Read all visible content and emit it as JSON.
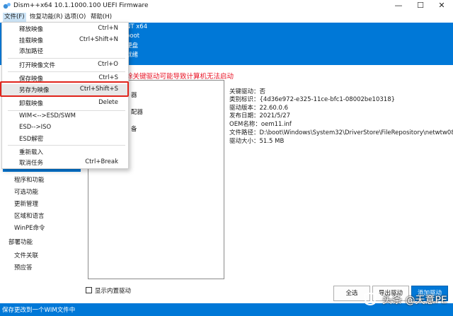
{
  "window": {
    "title": "Dism++x64 10.1.1000.100 UEFI Firmware",
    "controls": [
      "—",
      "☐",
      "✕"
    ]
  },
  "menubar": {
    "items": [
      "文件(F)",
      "恢复功能(R)",
      "选项(O)",
      "帮助(H)"
    ]
  },
  "header": {
    "lines": [
      "NT x64",
      "boot",
      "硬盘",
      "就绪"
    ]
  },
  "warning": "除关键驱动可能导致计算机无法启动",
  "tree_fragments": [
    "器",
    "配器",
    "备"
  ],
  "driver_info": {
    "critical": "关键驱动：否",
    "class_id": "类别标识：{4d36e972-e325-11ce-bfc1-08002be10318}",
    "version": "驱动版本：22.60.0.6",
    "date": "发布日期：2021/5/27",
    "oem_name": "OEM名称：oem11.inf",
    "path": "文件路径：D:\\boot\\Windows\\System32\\DriverStore\\FileRepository\\netwtw08.inf_",
    "size": "驱动大小：51.5 MB"
  },
  "leftnav": {
    "items": [
      "程序和功能",
      "可选功能",
      "更新管理",
      "区域和语言",
      "WinPE命令"
    ],
    "group": "部署功能",
    "group_items": [
      "文件关联",
      "预应答"
    ]
  },
  "checkbox_label": "显示内置驱动",
  "buttons": {
    "select_all": "全选",
    "export": "导出驱动",
    "add": "添加驱动"
  },
  "status": "保存更改到一个WIM文件中",
  "watermark": "头条 @天意PE",
  "file_menu": {
    "items": [
      {
        "label": "释放映像",
        "shortcut": "Ctrl+N"
      },
      {
        "label": "挂载映像",
        "shortcut": "Ctrl+Shift+N"
      },
      {
        "label": "添加路径",
        "shortcut": ""
      },
      {
        "label": "打开映像文件",
        "shortcut": "Ctrl+O"
      },
      {
        "label": "保存映像",
        "shortcut": "Ctrl+S"
      },
      {
        "label": "另存为映像",
        "shortcut": "Ctrl+Shift+S"
      },
      {
        "label": "卸载映像",
        "shortcut": "Delete"
      },
      {
        "label": "WIM<-->ESD/SWM",
        "shortcut": ""
      },
      {
        "label": "ESD-->ISO",
        "shortcut": ""
      },
      {
        "label": "ESD解密",
        "shortcut": ""
      },
      {
        "label": "重新载入",
        "shortcut": ""
      },
      {
        "label": "取消任务",
        "shortcut": "Ctrl+Break"
      }
    ]
  },
  "colors": {
    "accent": "#0078d7",
    "warning": "#e81123",
    "highlight_box": "#e0241b"
  }
}
